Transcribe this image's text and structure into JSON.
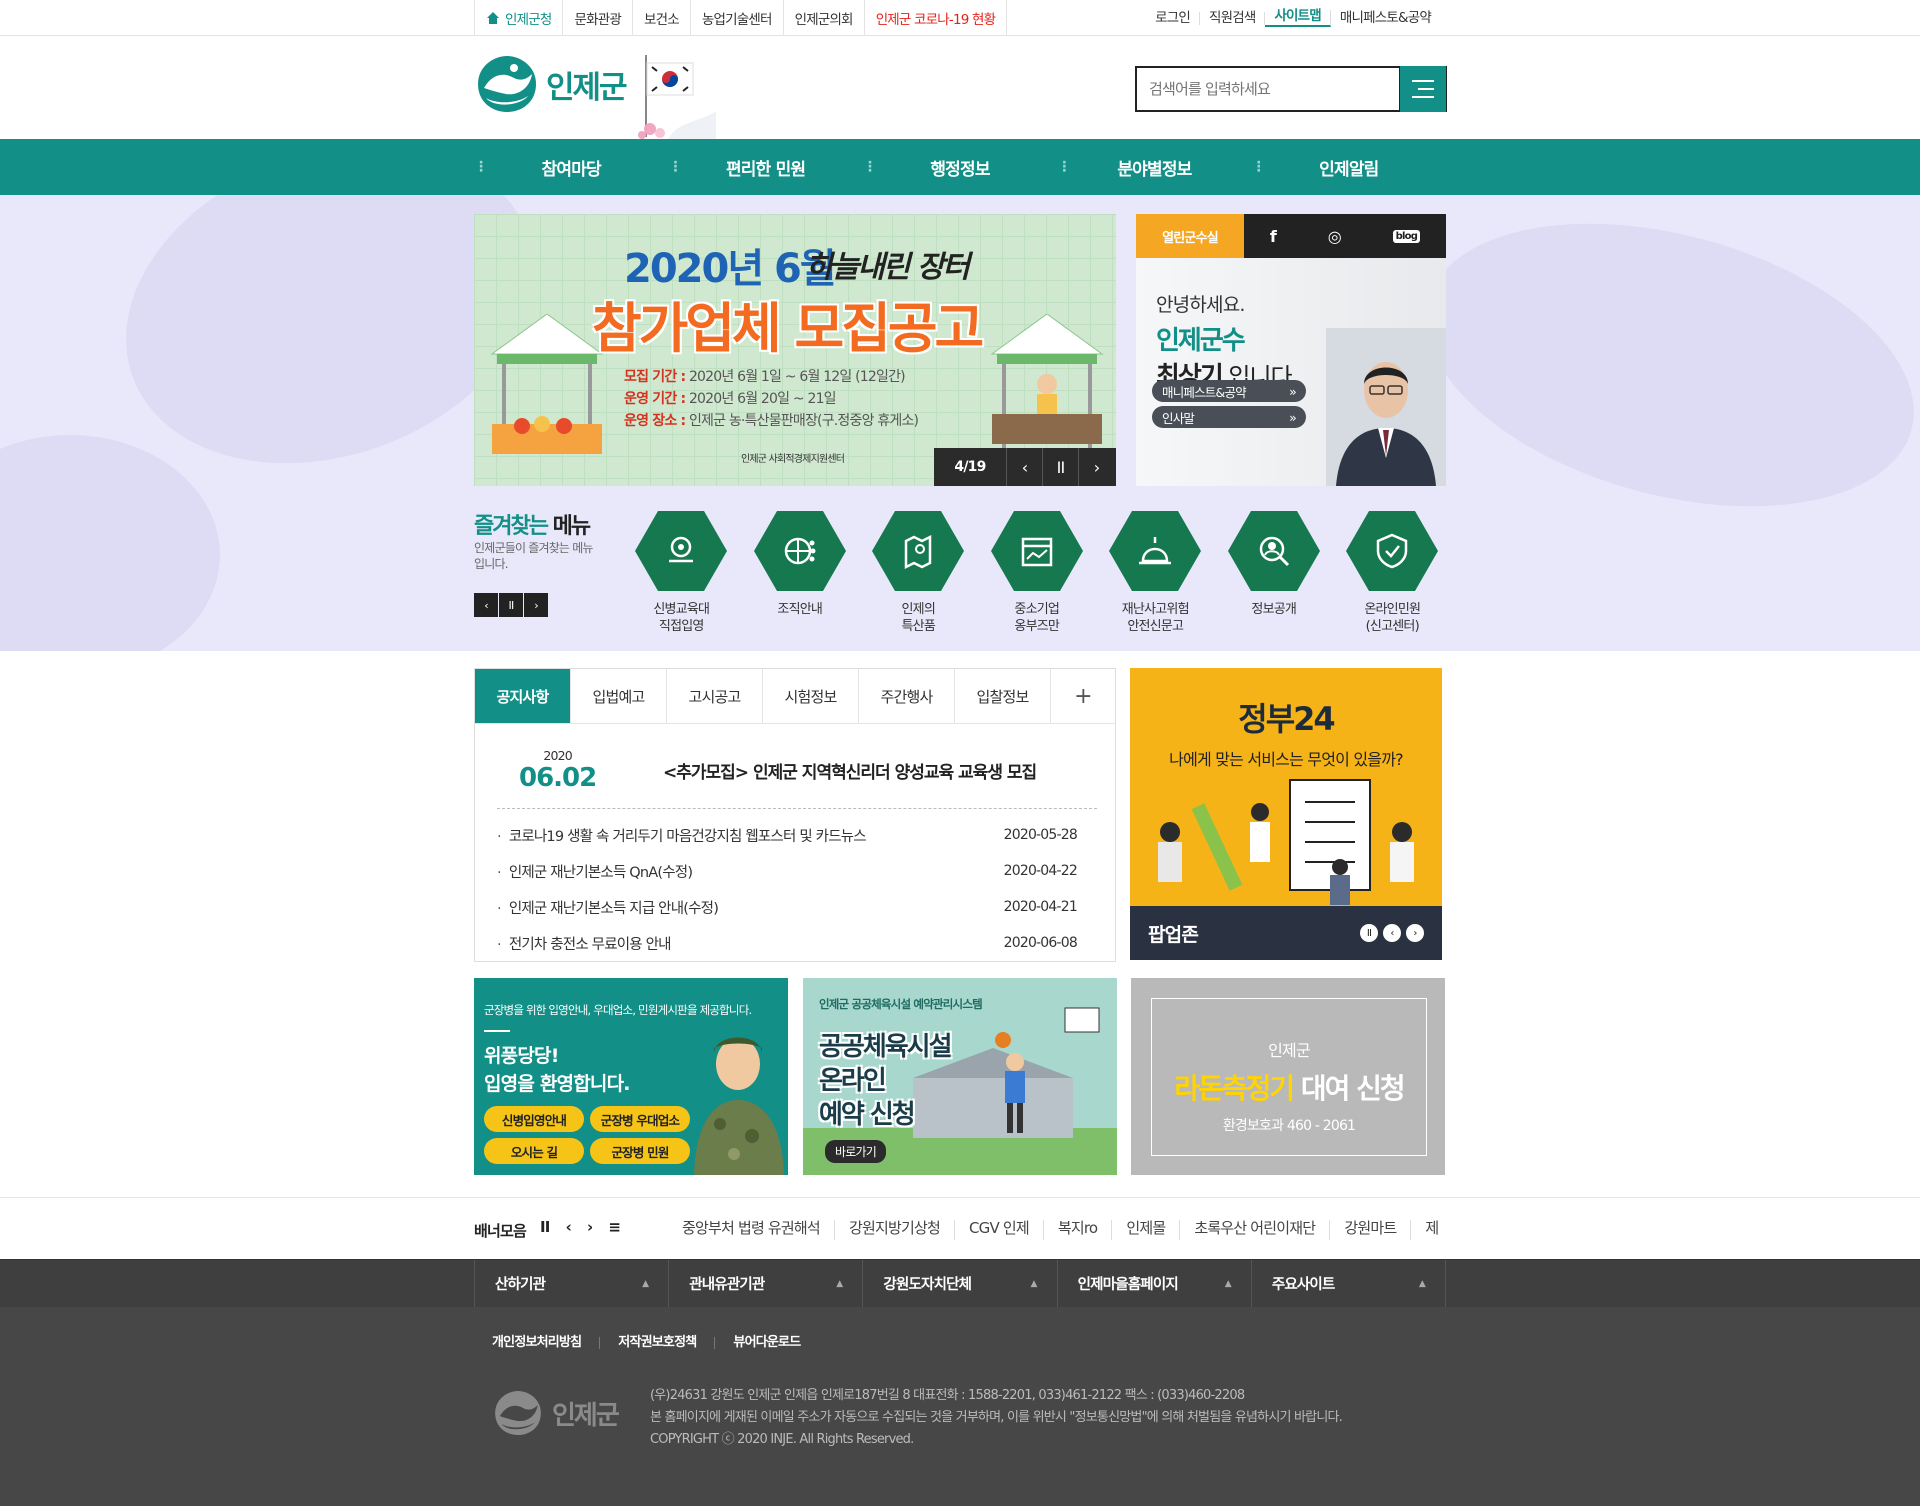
{
  "topbar": {
    "links": [
      "인제군청",
      "문화관광",
      "보건소",
      "농업기술센터",
      "인제군의회",
      "인제군 코로나-19 현황"
    ],
    "right": [
      "로그인",
      "직원검색",
      "사이트맵",
      "매니페스토&공약"
    ]
  },
  "header": {
    "logo": "인제군",
    "search_placeholder": "검색어를 입력하세요"
  },
  "gnb": [
    "참여마당",
    "편리한 민원",
    "행정정보",
    "분야별정보",
    "인제알림"
  ],
  "slide": {
    "year": "2020년 6월",
    "brand": "하늘내린 장터",
    "title": "참가업체 모집공고",
    "info": [
      {
        "k": "모집 기간 :",
        "v": "2020년 6월 1일 ~ 6월 12일 (12일간)"
      },
      {
        "k": "운영 기간 :",
        "v": "2020년 6월 20일 ~ 21일"
      },
      {
        "k": "운영 장소 :",
        "v": "인제군 농·특산물판매장(구.정중앙 휴게소)"
      }
    ],
    "org": "인제군 사회적경제지원센터",
    "counter": "4/19"
  },
  "mayor": {
    "tab": "열린군수실",
    "sns": [
      "f",
      "◎",
      "blog"
    ],
    "hello": "안녕하세요.",
    "title": "인제군수",
    "name": "최상기",
    "suffix": " 입니다.",
    "btn1": "매니페스트&공약",
    "btn2": "인사말"
  },
  "quick": {
    "title1": "즐겨찾는",
    "title2": "메뉴",
    "desc": "인제군들이 즐겨찾는 메뉴입니다.",
    "items": [
      {
        "l1": "신병교육대",
        "l2": "직접입영"
      },
      {
        "l1": "조직안내",
        "l2": ""
      },
      {
        "l1": "인제의",
        "l2": "특산품"
      },
      {
        "l1": "중소기업",
        "l2": "옹부즈만"
      },
      {
        "l1": "재난사고위험",
        "l2": "안전신문고"
      },
      {
        "l1": "정보공개",
        "l2": ""
      },
      {
        "l1": "온라인민원",
        "l2": "(신고센터)"
      }
    ]
  },
  "notice": {
    "tabs": [
      "공지사항",
      "입법예고",
      "고시공고",
      "시험정보",
      "주간행사",
      "입찰정보"
    ],
    "plus": "+",
    "main": {
      "year": "2020",
      "date": "06.02",
      "title": "<추가모집> 인제군 지역혁신리더 양성교육 교육생 모집"
    },
    "list": [
      {
        "t": "코로나19 생활 속 거리두기 마음건강지침 웹포스터 및 카드뉴스",
        "d": "2020-05-28"
      },
      {
        "t": "인제군 재난기본소득 QnA(수정)",
        "d": "2020-04-22"
      },
      {
        "t": "인제군 재난기본소득 지급 안내(수정)",
        "d": "2020-04-21"
      },
      {
        "t": "전기차 충전소 무료이용 안내",
        "d": "2020-06-08"
      }
    ]
  },
  "gov": {
    "title": "정부24",
    "sub": "나에게 맞는 서비스는 무엇이 있을까?",
    "label": "팝업존"
  },
  "banners": {
    "a": {
      "sub": "군장병을 위한 입영안내, 우대업소, 민원게시판을 제공합니다.",
      "h1": "위풍당당!",
      "h2": "입영을 환영합니다.",
      "p": [
        "신병입영안내",
        "군장병 우대업소",
        "오시는 길",
        "군장병 민원"
      ]
    },
    "b": {
      "sub": "인제군 공공체육시설 예약관리시스템",
      "h": [
        "공공체육시설",
        "온라인",
        "예약 신청"
      ],
      "go": "바로가기"
    },
    "c": {
      "s1": "인제군",
      "s2a": "라돈측정기",
      "s2b": " 대여 신청",
      "s3": "환경보호과 460 - 2061"
    }
  },
  "bannerlinks": {
    "label": "배너모음",
    "ctrl": [
      "II",
      "‹",
      "›",
      "≡"
    ],
    "items": [
      "중앙부처 법령 유권해석",
      "강원지방기상청",
      "CGV 인제",
      "복지ro",
      "인제몰",
      "초록우산 어린이재단",
      "강원마트",
      "제"
    ]
  },
  "footer": {
    "selects": [
      "산하기관",
      "관내유관기관",
      "강원도자치단체",
      "인제마을홈페이지",
      "주요사이트"
    ],
    "links": [
      "개인정보처리방침",
      "저작권보호정책",
      "뷰어다운로드"
    ],
    "logo": "인제군",
    "info": [
      "(우)24631 강원도 인제군 인제읍 인제로187번길 8 대표전화 : 1588-2201, 033)461-2122 팩스 : (033)460-2208",
      "본 홈페이지에 게재된 이메일 주소가 자동으로 수집되는 것을 거부하며, 이를 위반시 \"정보통신망법\"에 의해 처벌됨을 유념하시기 바랍니다.",
      "COPYRIGHT ⓒ 2020 INJE. All Rights Reserved."
    ]
  },
  "colors": {
    "brand": "#128f86",
    "accent": "#f5a623",
    "alert": "#e4231c"
  }
}
